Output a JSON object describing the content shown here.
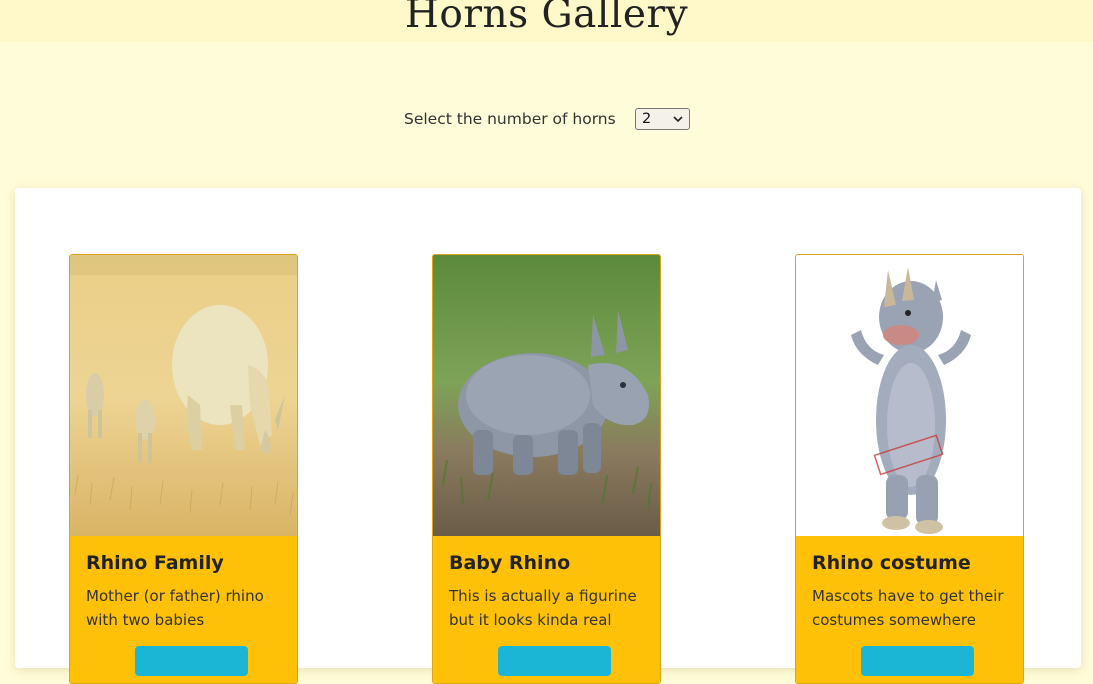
{
  "header": {
    "title": "Horns Gallery"
  },
  "filter": {
    "label": "Select the number of horns",
    "selected": "2",
    "chevron_icon": "chevron-down-icon"
  },
  "cards": [
    {
      "title": "Rhino Family",
      "description": "Mother (or father) rhino with two babies",
      "image_icon": "rhino-family-photo"
    },
    {
      "title": "Baby Rhino",
      "description": "This is actually a figurine but it looks kinda real",
      "image_icon": "baby-rhino-figurine-photo"
    },
    {
      "title": "Rhino costume",
      "description": "Mascots have to get their costumes somewhere",
      "image_icon": "rhino-mascot-costume-photo"
    }
  ],
  "colors": {
    "page_background": "#fffcd9",
    "header_background": "#fff8c8",
    "card_background": "#ffc107",
    "button_color": "#1bb6d6"
  }
}
